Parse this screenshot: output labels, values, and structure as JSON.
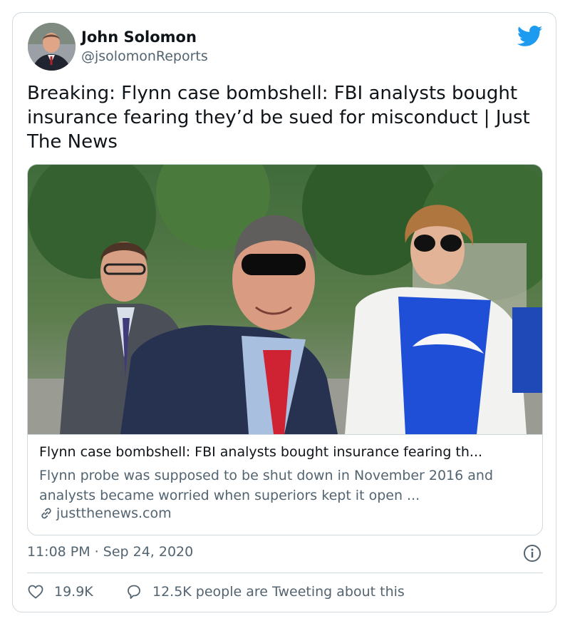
{
  "author": {
    "name": "John Solomon",
    "handle": "@jsolomonReports"
  },
  "tweet": {
    "text": "Breaking: Flynn case bombshell: FBI analysts bought insurance fearing they’d be sued for misconduct | Just The News",
    "timestamp": "11:08 PM · Sep 24, 2020"
  },
  "link_card": {
    "title": "Flynn case bombshell: FBI analysts bought insurance fearing th...",
    "description": "Flynn probe was supposed to be shut down in November 2016 and analysts became worried when superiors kept it open ...",
    "domain": "justthenews.com"
  },
  "engagement": {
    "likes": "19.9K",
    "tweeting": "12.5K people are Tweeting about this"
  },
  "icons": {
    "brand": "twitter-bird-icon",
    "info": "info-icon",
    "like": "heart-icon",
    "reply": "speech-bubble-icon",
    "link": "link-icon"
  },
  "colors": {
    "brand": "#1d9bf0",
    "text": "#0f1419",
    "secondary": "#536471",
    "border": "#cfd9de"
  }
}
